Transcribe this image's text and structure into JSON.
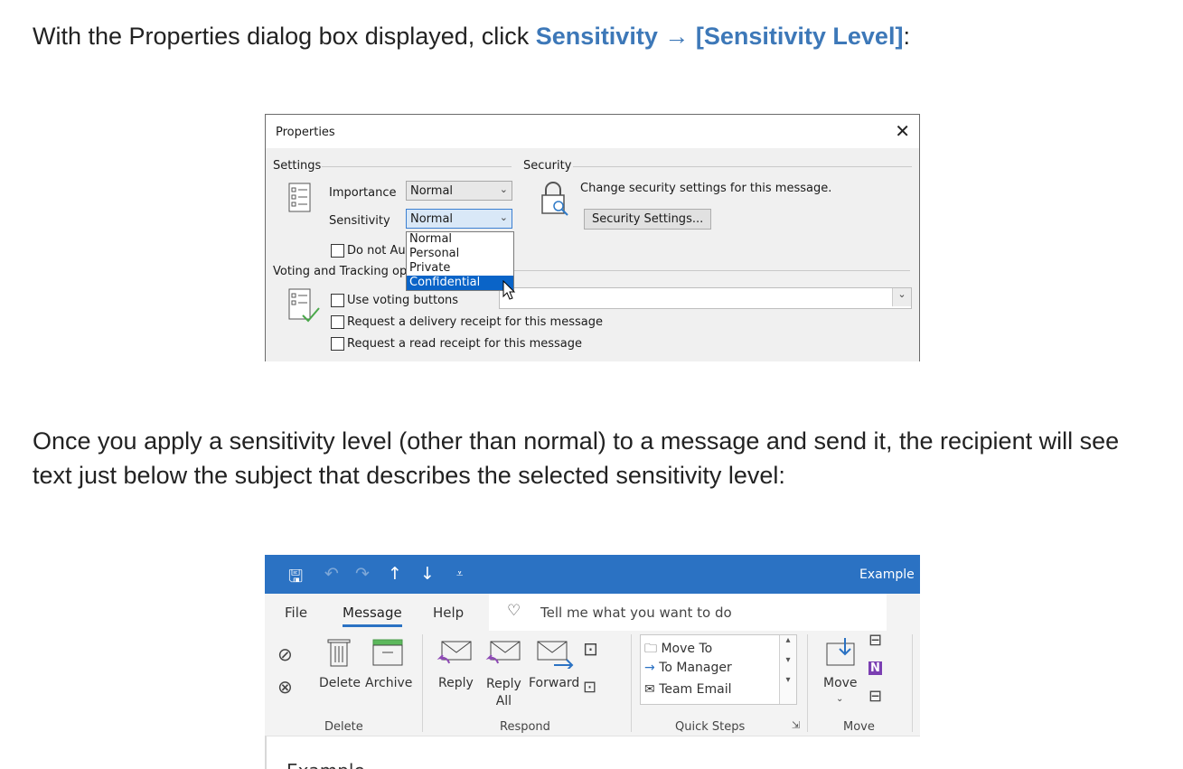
{
  "intro": {
    "before": "With the Properties dialog box displayed, click ",
    "link1": "Sensitivity",
    "arrow": " → ",
    "link2": "[Sensitivity Level]",
    "after": ":"
  },
  "properties_dialog": {
    "title": "Properties",
    "close": "✕",
    "settings_label": "Settings",
    "security_label": "Security",
    "importance_label": "Importance",
    "importance_value": "Normal",
    "sensitivity_label": "Sensitivity",
    "sensitivity_value": "Normal",
    "do_not_autoarchive": "Do not Au",
    "sensitivity_options": [
      "Normal",
      "Personal",
      "Private",
      "Confidential"
    ],
    "security_text": "Change security settings for this message.",
    "security_button": "Security Settings...",
    "voting_label": "Voting and Tracking op",
    "use_voting": "Use voting buttons",
    "delivery_receipt": "Request a delivery receipt for this message",
    "read_receipt": "Request a read receipt for this message"
  },
  "middle_text": "Once you apply a sensitivity level (other than normal) to a message and send it, the recipient will see text just below the subject that describes the selected sensitivity level:",
  "ribbon": {
    "window_title": "Example",
    "tabs": [
      "File",
      "Message",
      "Help"
    ],
    "active_tab": "Message",
    "tell_me": "Tell me what you want to do",
    "delete_label": "Delete",
    "archive_label": "Archive",
    "reply_label": "Reply",
    "reply_all_label": "Reply\nAll",
    "forward_label": "Forward",
    "quick_steps": [
      "Move To",
      "To Manager",
      "Team Email"
    ],
    "move_label": "Move",
    "groups": [
      "Delete",
      "Respond",
      "Quick Steps",
      "Move"
    ],
    "message_subject_partial": "Example"
  }
}
